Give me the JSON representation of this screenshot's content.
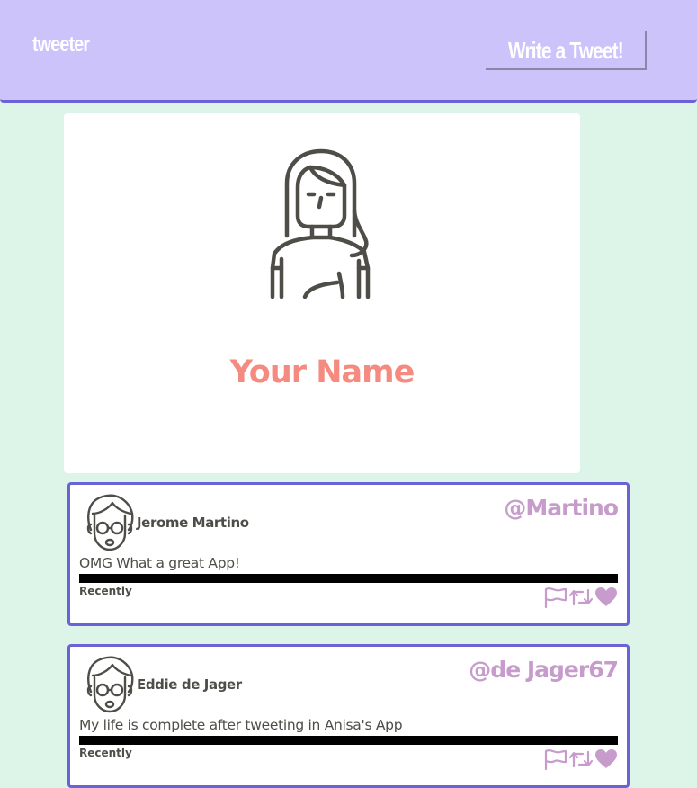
{
  "navbar": {
    "brand": "tweeter",
    "write_button": "Write a Tweet!",
    "color": "#cdc3fb"
  },
  "profile": {
    "name": "Your Name",
    "avatar_icon": "woman-avatar-icon",
    "name_color": "#f58b80"
  },
  "tweets": [
    {
      "name": "Jerome Martino",
      "handle": "@Martino",
      "text": "OMG What a great App!",
      "time": "Recently",
      "avatar_icon": "man-with-glasses-avatar-icon"
    },
    {
      "name": "Eddie de Jager",
      "handle": "@de Jager67",
      "text": "My life is complete after tweeting in Anisa's App",
      "time": "Recently",
      "avatar_icon": "man-with-glasses-avatar-icon"
    }
  ],
  "actions": {
    "flag": "flag-icon",
    "retweet": "retweet-icon",
    "like": "heart-icon"
  },
  "colors": {
    "background": "#ddf4e8",
    "accent_border": "#6b62d8",
    "handle": "#c79ccc"
  }
}
